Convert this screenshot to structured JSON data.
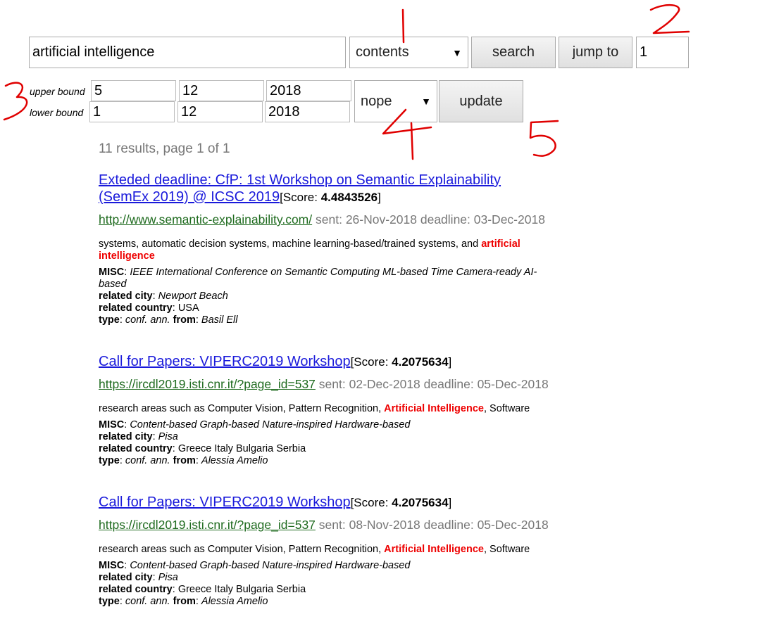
{
  "search": {
    "query": "artificial intelligence",
    "field_option": "contents",
    "search_label": "search",
    "jump_label": "jump to",
    "page_input": "1"
  },
  "bounds": {
    "upper_label": "upper bound",
    "lower_label": "lower bound",
    "upper": {
      "day": "5",
      "month": "12",
      "year": "2018"
    },
    "lower": {
      "day": "1",
      "month": "12",
      "year": "2018"
    },
    "sort_option": "nope",
    "update_label": "update"
  },
  "summary": "11 results, page 1 of 1",
  "annotations": [
    "1",
    "2",
    "3",
    "4",
    "5"
  ],
  "annotation_color": "#e00000",
  "labels": {
    "score_prefix": "[Score: ",
    "score_suffix": "]",
    "sent": "sent: ",
    "deadline": "deadline: ",
    "misc": "MISC",
    "related_city": "related city",
    "related_country": "related country",
    "type": "type",
    "from": "from"
  },
  "results": [
    {
      "title_line1": "Exteded deadline: CfP: 1st Workshop on Semantic Explainability",
      "title_line2": "(SemEx 2019) @ ICSC 2019",
      "score": "4.4843526",
      "url": "http://www.semantic-explainability.com/",
      "sent": "26-Nov-2018",
      "deadline": "03-Dec-2018",
      "snippet_pre": "systems, automatic decision systems, machine learning-based/trained systems, and ",
      "snippet_hl": "artificial intelligence",
      "snippet_post": "",
      "misc_line1": "IEEE International Conference on Semantic Computing ML-based Time Camera-ready AI-",
      "misc_line2": "based",
      "city": "Newport Beach",
      "country": "USA",
      "type": "conf. ann.",
      "from": "Basil Ell"
    },
    {
      "title_line1": "Call for Papers: VIPERC2019 Workshop",
      "title_line2": "",
      "score": "4.2075634",
      "url": "https://ircdl2019.isti.cnr.it/?page_id=537",
      "sent": "02-Dec-2018",
      "deadline": "05-Dec-2018",
      "snippet_pre": "research areas such as Computer Vision, Pattern Recognition, ",
      "snippet_hl": "Artificial Intelligence",
      "snippet_post": ", Software",
      "misc_line1": "Content-based Graph-based Nature-inspired Hardware-based",
      "misc_line2": "",
      "city": "Pisa",
      "country": "Greece Italy Bulgaria Serbia",
      "type": "conf. ann.",
      "from": "Alessia Amelio"
    },
    {
      "title_line1": "Call for Papers: VIPERC2019 Workshop",
      "title_line2": "",
      "score": "4.2075634",
      "url": "https://ircdl2019.isti.cnr.it/?page_id=537",
      "sent": "08-Nov-2018",
      "deadline": "05-Dec-2018",
      "snippet_pre": "research areas such as Computer Vision, Pattern Recognition, ",
      "snippet_hl": "Artificial Intelligence",
      "snippet_post": ", Software",
      "misc_line1": "Content-based Graph-based Nature-inspired Hardware-based",
      "misc_line2": "",
      "city": "Pisa",
      "country": "Greece Italy Bulgaria Serbia",
      "type": "conf. ann.",
      "from": "Alessia Amelio"
    }
  ]
}
